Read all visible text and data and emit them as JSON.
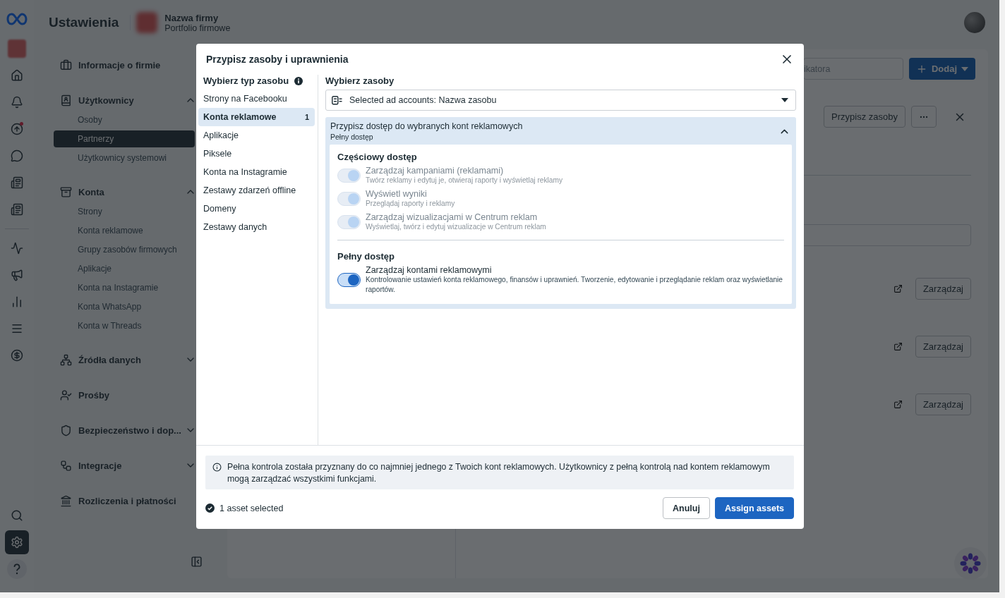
{
  "header": {
    "title": "Ustawienia",
    "business": {
      "name": "Nazwa firmy",
      "subtitle": "Portfolio firmowe"
    }
  },
  "rail": {
    "items": [
      {
        "selected": false,
        "notification": false
      },
      {
        "selected": false,
        "notification": false
      },
      {
        "selected": false,
        "notification": true
      },
      {
        "selected": false,
        "notification": false
      },
      {
        "selected": false,
        "notification": false
      },
      {
        "selected": false,
        "notification": false
      },
      {
        "selected": false,
        "notification": false
      },
      {
        "selected": false,
        "notification": false
      },
      {
        "selected": false,
        "notification": false
      },
      {
        "selected": false,
        "notification": false
      },
      {
        "selected": false,
        "notification": false
      }
    ],
    "bottom": [
      {
        "selected": false
      },
      {
        "selected": true
      },
      {
        "selected": false
      }
    ]
  },
  "sidebar": {
    "sections": [
      {
        "label": "Informacje o firmie",
        "kind": "link"
      },
      {
        "label": "Użytkownicy",
        "kind": "group",
        "expanded": true,
        "children": [
          {
            "label": "Osoby",
            "selected": false
          },
          {
            "label": "Partnerzy",
            "selected": true
          },
          {
            "label": "Użytkownicy systemowi",
            "selected": false
          }
        ]
      },
      {
        "label": "Konta",
        "kind": "group",
        "expanded": true,
        "children": [
          {
            "label": "Strony",
            "selected": false
          },
          {
            "label": "Konta reklamowe",
            "selected": false
          },
          {
            "label": "Grupy zasobów firmowych",
            "selected": false
          },
          {
            "label": "Aplikacje",
            "selected": false
          },
          {
            "label": "Konta na Instagramie",
            "selected": false
          },
          {
            "label": "Konta WhatsApp",
            "selected": false
          },
          {
            "label": "Konta w Threads",
            "selected": false
          }
        ]
      },
      {
        "label": "Źródła danych",
        "kind": "group",
        "expanded": false
      },
      {
        "label": "Prośby",
        "kind": "link"
      },
      {
        "label": "Bezpieczeństwo i dop...",
        "kind": "group",
        "expanded": false
      },
      {
        "label": "Integracje",
        "kind": "group",
        "expanded": false
      },
      {
        "label": "Rozliczenia i płatności",
        "kind": "link"
      }
    ]
  },
  "toolbar": {
    "search": {
      "placeholder": "ikatora"
    },
    "add_button": "Dodaj"
  },
  "detail": {
    "assign_button": "Przypisz zasoby",
    "rows": [
      {
        "action": "Zarządzaj"
      },
      {
        "action": "Zarządzaj"
      },
      {
        "action": "Zarządzaj"
      }
    ]
  },
  "dialog": {
    "title": "Przypisz zasoby i uprawnienia",
    "asset_types": {
      "heading": "Wybierz typ zasobu",
      "items": [
        {
          "label": "Strony na Facebooku",
          "selected": false
        },
        {
          "label": "Konta reklamowe",
          "selected": true,
          "count": "1"
        },
        {
          "label": "Aplikacje",
          "selected": false
        },
        {
          "label": "Piksele",
          "selected": false
        },
        {
          "label": "Konta na Instagramie",
          "selected": false
        },
        {
          "label": "Zestawy zdarzeń offline",
          "selected": false
        },
        {
          "label": "Domeny",
          "selected": false
        },
        {
          "label": "Zestawy danych",
          "selected": false
        }
      ]
    },
    "assets": {
      "heading": "Wybierz zasoby",
      "dropdown": {
        "value": "Selected ad accounts: Nazwa zasobu"
      },
      "access_panel": {
        "title": "Przypisz dostęp do wybranych kont reklamowych",
        "subtitle": "Pełny dostęp",
        "expanded": true,
        "groups": [
          {
            "title": "Częściowy dostęp",
            "permissions": [
              {
                "label": "Zarządzaj kampaniami (reklamami)",
                "description": "Twórz reklamy i edytuj je, otwieraj raporty i wyświetlaj reklamy",
                "on": true,
                "disabled": true
              },
              {
                "label": "Wyświetl wyniki",
                "description": "Przeglądaj raporty i reklamy",
                "on": true,
                "disabled": true
              },
              {
                "label": "Zarządzaj wizualizacjami w Centrum reklam",
                "description": "Wyświetlaj, twórz i edytuj wizualizacje w Centrum reklam",
                "on": true,
                "disabled": true
              }
            ]
          },
          {
            "title": "Pełny dostęp",
            "permissions": [
              {
                "label": "Zarządzaj kontami reklamowymi",
                "description": "Kontrolowanie ustawień konta reklamowego, finansów i uprawnień. Tworzenie, edytowanie i przeglądanie reklam oraz wyświetlanie raportów.",
                "on": true,
                "disabled": false
              }
            ]
          }
        ]
      }
    },
    "notice": "Pełna kontrola została przyznany do co najmniej jednego z Twoich kont reklamowych. Użytkownicy z pełną kontrolą nad kontem reklamowym mogą zarządzać wszystkimi funkcjami.",
    "selection": "1 asset selected",
    "buttons": [
      {
        "label": "Anuluj",
        "kind": "secondary"
      },
      {
        "label": "Assign assets",
        "kind": "primary"
      }
    ]
  }
}
